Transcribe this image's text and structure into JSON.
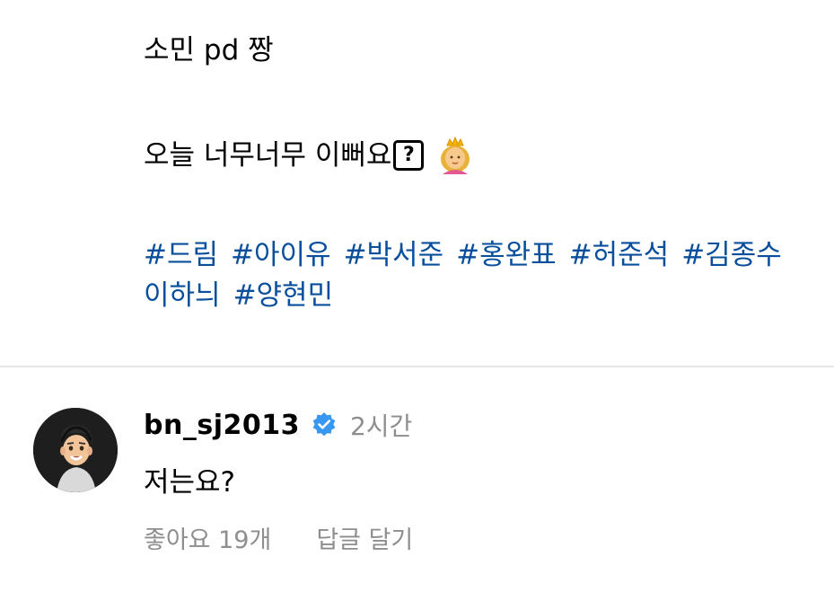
{
  "post": {
    "caption_line1": "소민 pd 짱",
    "caption_line2": "오늘 너무너무 이뻐요",
    "caption_unknown_glyph": "?",
    "caption_emoji_icon": "princess-emoji",
    "hashtags_line1": [
      "#드림",
      "#아이유",
      "#박서준",
      "#홍완표",
      "#허준석",
      "#김종수"
    ],
    "hashtags_line2": [
      "이하늬",
      "#양현민"
    ]
  },
  "comment": {
    "avatar_icon": "memoji-avatar",
    "username": "bn_sj2013",
    "verified_icon": "verified-badge-icon",
    "verified_color": "#3897f0",
    "time": "2시간",
    "text": "저는요?",
    "likes": "좋아요 19개",
    "reply": "답글 달기"
  },
  "colors": {
    "hashtag": "#0a4f9c",
    "muted": "#8e8e8e",
    "divider": "#e6e6e6"
  }
}
